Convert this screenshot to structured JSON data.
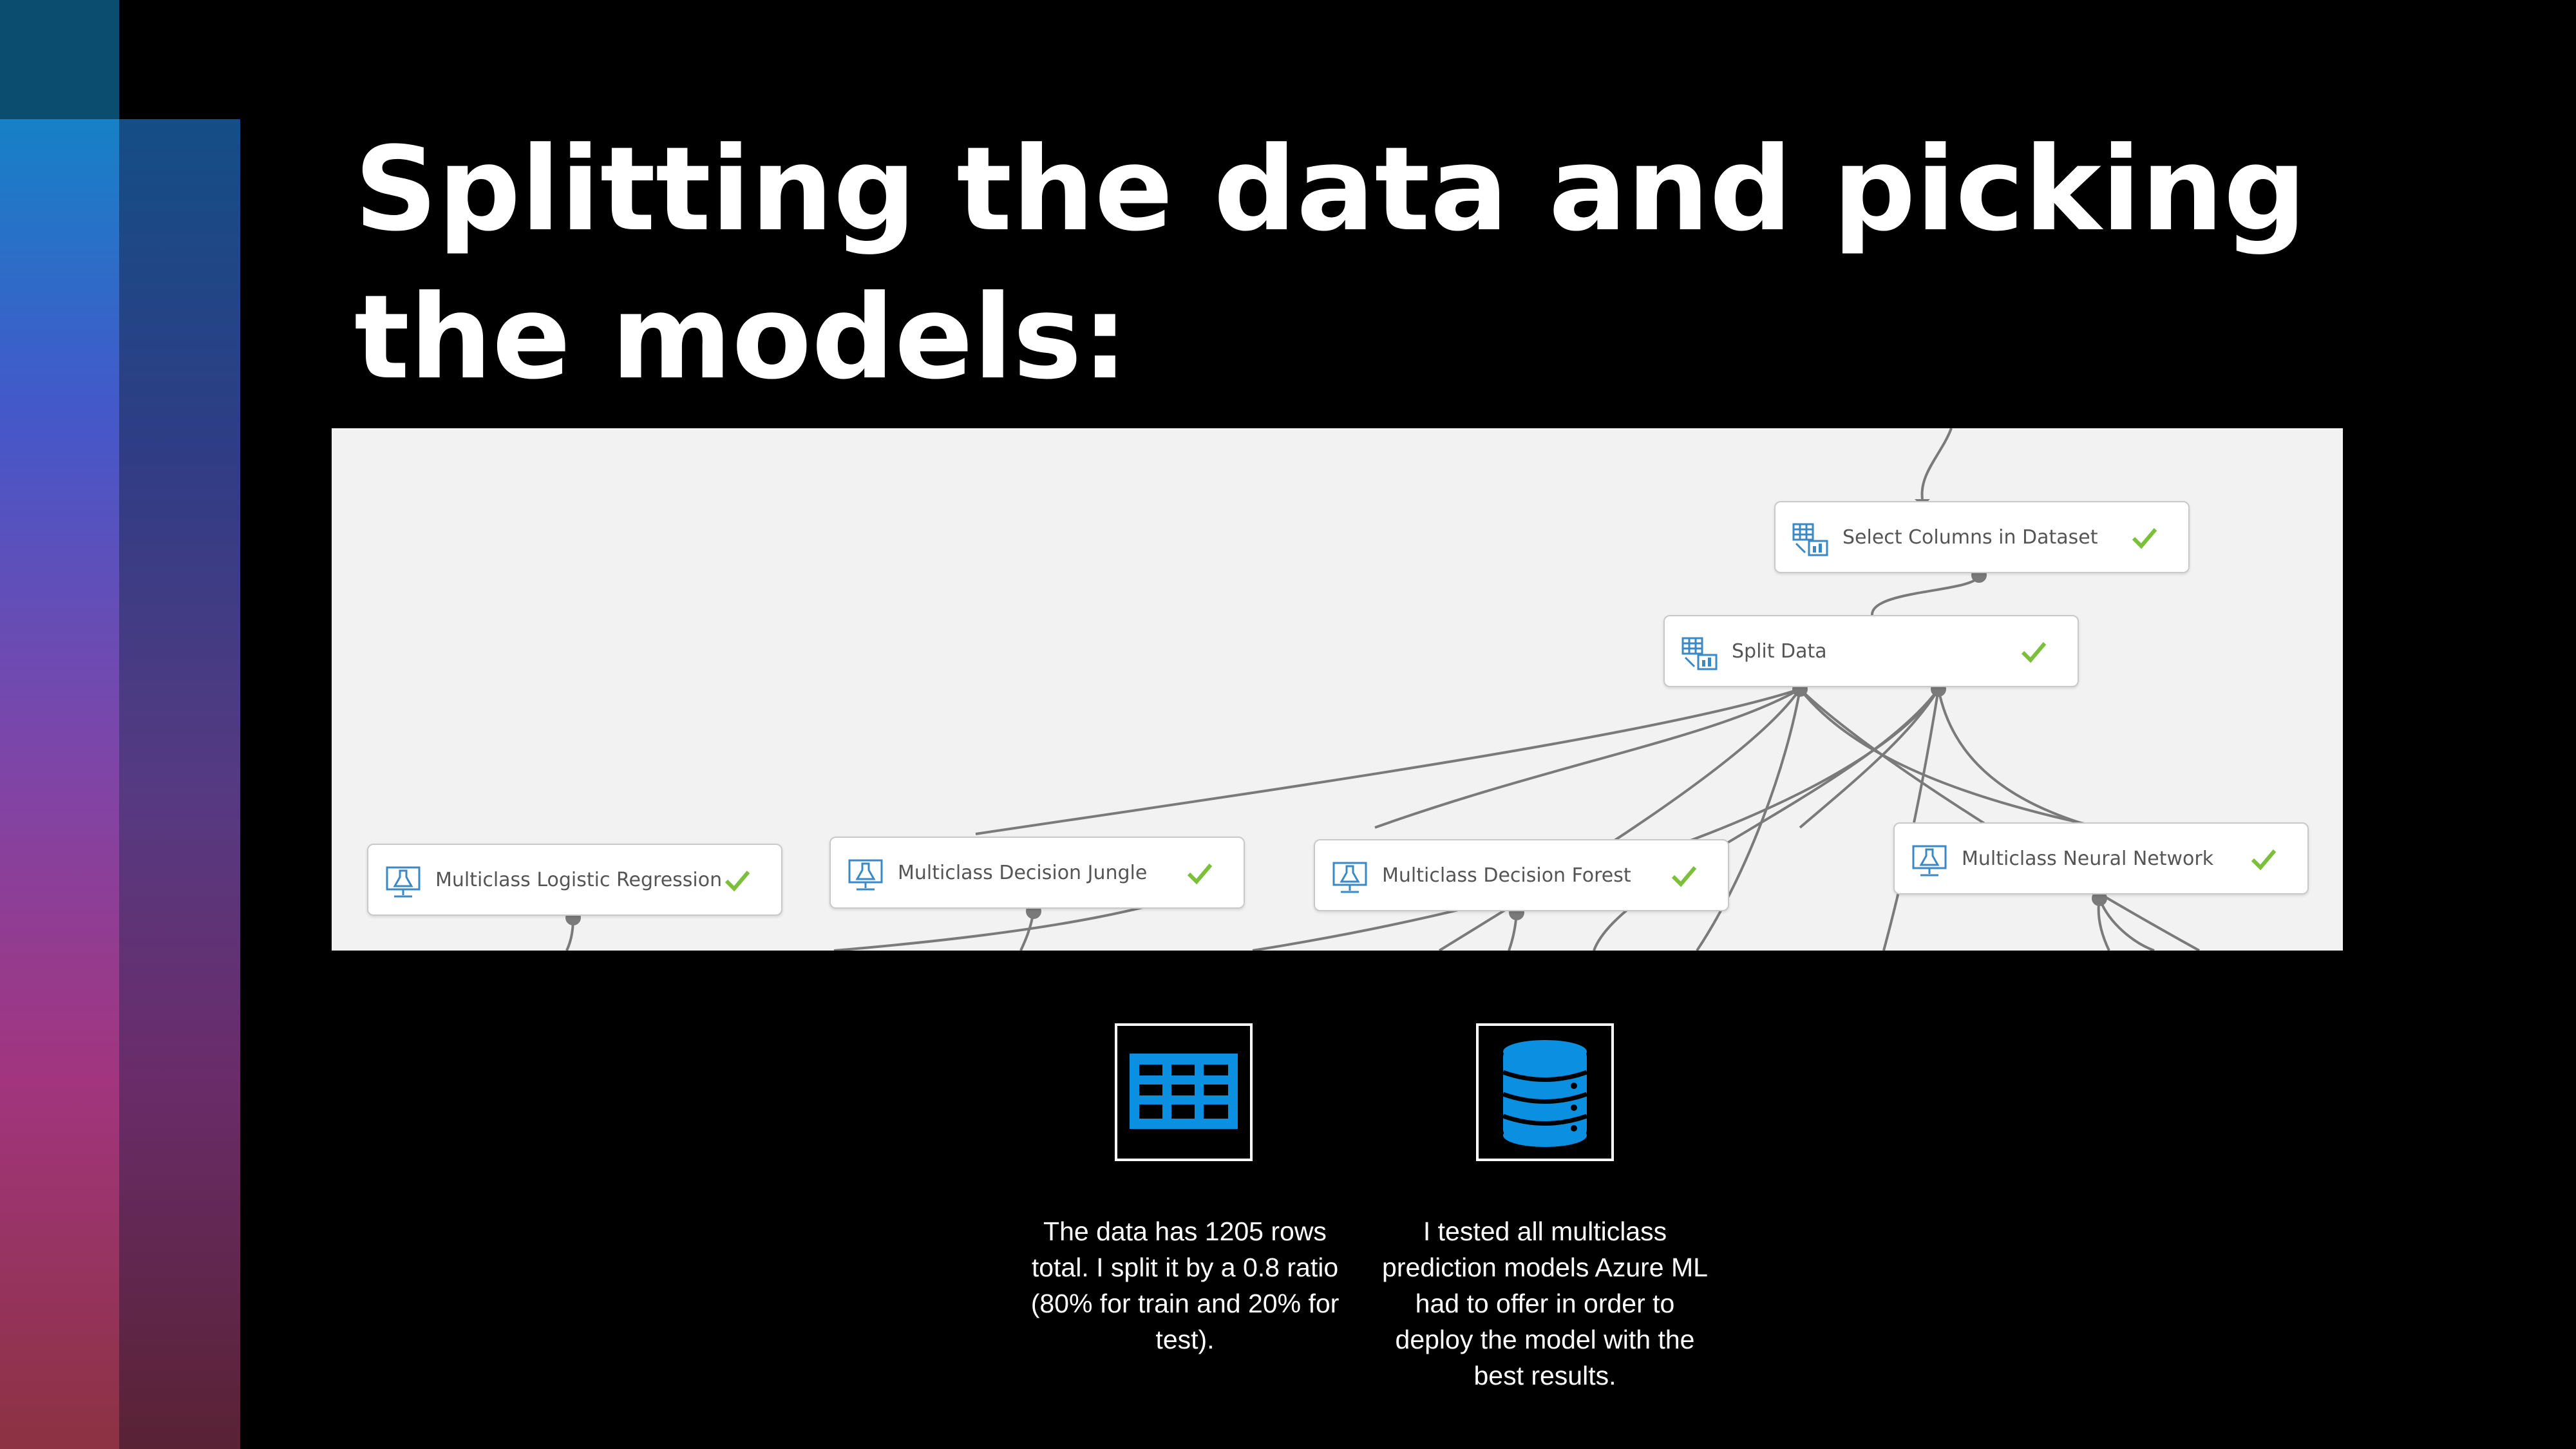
{
  "slide": {
    "title": "Splitting the data and picking the models:"
  },
  "canvas": {
    "nodes": {
      "select_columns": "Select Columns in Dataset",
      "split_data": "Split Data",
      "logistic": "Multiclass Logistic Regression",
      "jungle": "Multiclass Decision Jungle",
      "forest": "Multiclass Decision Forest",
      "neural": "Multiclass Neural Network"
    },
    "status": "completed",
    "colors": {
      "canvas_bg": "#f2f2f2",
      "check": "#7cbf3b",
      "icon": "#3a88c4",
      "wire": "#777777"
    }
  },
  "tiles": {
    "table_caption": "The data has 1205 rows total. I split it by a 0.8 ratio (80% for train and 20% for test).",
    "database_caption": "I tested all multiclass prediction models Azure ML had to offer in order to deploy the model with the best results.",
    "icon_color": "#0b8fe0",
    "icons": [
      "table-icon",
      "database-icon"
    ]
  }
}
